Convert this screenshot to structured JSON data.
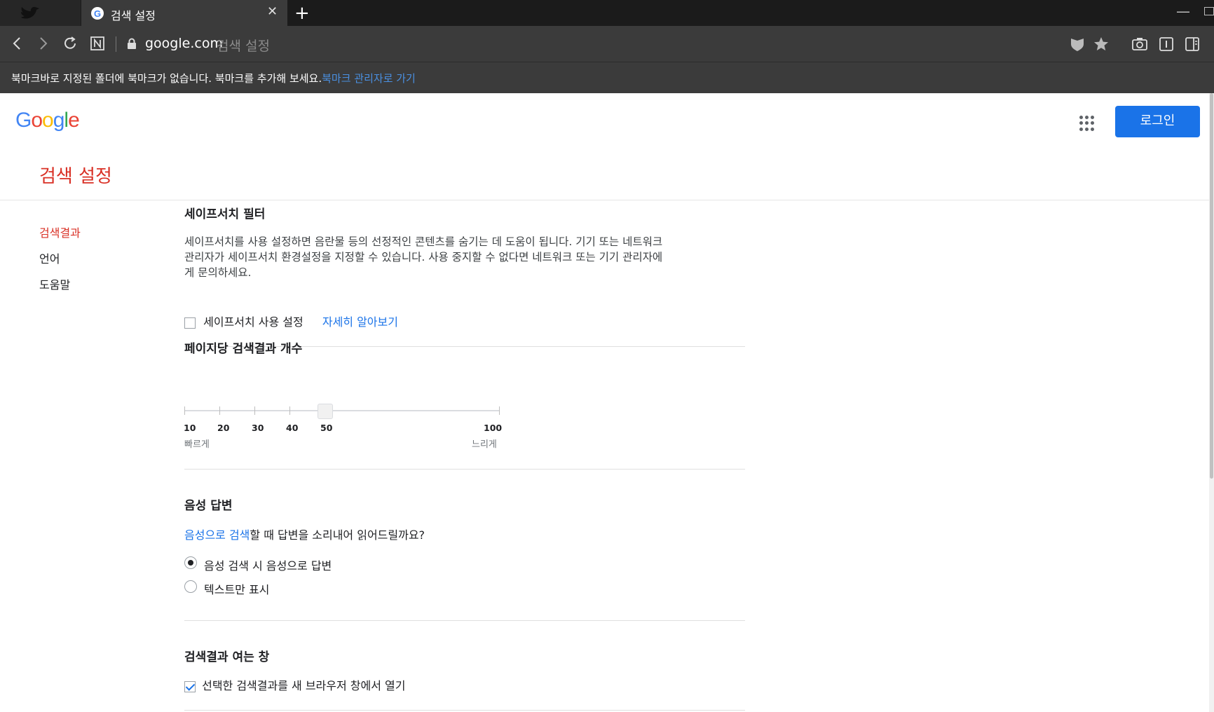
{
  "browser": {
    "tab": {
      "title": "검색 설정",
      "close": "✕"
    },
    "new_tab": "+",
    "url": {
      "domain": "google.com",
      "page_title": "검색 설정"
    },
    "bookmark_bar": {
      "message": "북마크바로 지정된 폴더에 북마크가 없습니다. 북마크를 추가해 보세요.",
      "link": "북마크 관리자로 가기"
    }
  },
  "page": {
    "logo": [
      "G",
      "o",
      "o",
      "g",
      "l",
      "e"
    ],
    "logo_colors": [
      "#4285F4",
      "#EA4335",
      "#FBBC05",
      "#4285F4",
      "#34A853",
      "#EA4335"
    ],
    "login_label": "로그인",
    "title": "검색 설정",
    "accent": "#1a73e8",
    "title_color": "#d93025"
  },
  "sidebar": {
    "items": [
      {
        "label": "검색결과",
        "active": true
      },
      {
        "label": "언어",
        "active": false
      },
      {
        "label": "도움말",
        "active": false
      }
    ]
  },
  "safesearch": {
    "title": "세이프서치 필터",
    "description_1": "세이프서치를 사용 설정하면 음란물 등의 선정적인 콘텐츠를 숨기는 데 도움이 됩니다. 기기 또는 네트워크",
    "description_2": "관리자가 세이프서치 환경설정을 지정할 수 있습니다. 사용 중지할 수 없다면 네트워크 또는 기기 관리자에",
    "description_3": "게 문의하세요.",
    "checkbox_label": "세이프서치 사용 설정",
    "checked": false,
    "learn_more": "자세히 알아보기"
  },
  "results_per_page": {
    "title": "페이지당 검색결과 개수",
    "ticks": [
      "10",
      "20",
      "30",
      "40",
      "50",
      "100"
    ],
    "selected": "50",
    "left_caption": "빠르게",
    "right_caption": "느리게"
  },
  "voice": {
    "title": "음성 답변",
    "question_link": "음성으로 검색",
    "question_rest": "할 때 답변을 소리내어 읽어드릴까요?",
    "options": [
      {
        "label": "음성 검색 시 음성으로 답변",
        "selected": true
      },
      {
        "label": "텍스트만 표시",
        "selected": false
      }
    ]
  },
  "open_window": {
    "title": "검색결과 여는 창",
    "checkbox_label": "선택한 검색결과를 새 브라우저 창에서 열기",
    "checked": true
  }
}
